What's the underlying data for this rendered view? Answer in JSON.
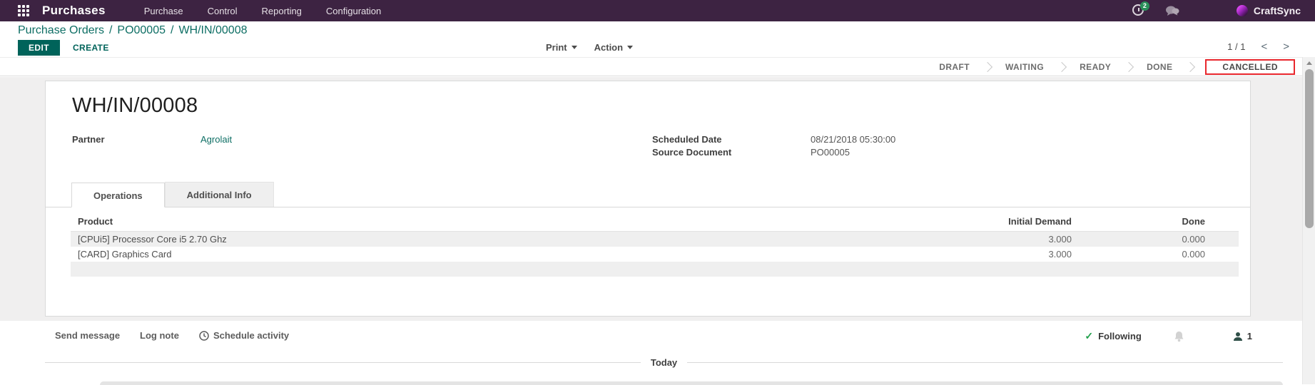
{
  "topbar": {
    "app_name": "Purchases",
    "menus": [
      "Purchase",
      "Control",
      "Reporting",
      "Configuration"
    ],
    "activity_badge": "2",
    "company": "CraftSync"
  },
  "control_panel": {
    "breadcrumb": [
      "Purchase Orders",
      "PO00005",
      "WH/IN/00008"
    ],
    "separator": "/",
    "edit_label": "EDIT",
    "create_label": "CREATE",
    "print_label": "Print",
    "action_label": "Action",
    "pager": "1 / 1",
    "pager_prev": "<",
    "pager_next": ">"
  },
  "statusbar": {
    "states": [
      "DRAFT",
      "WAITING",
      "READY",
      "DONE",
      "CANCELLED"
    ],
    "active": "CANCELLED"
  },
  "sheet": {
    "title": "WH/IN/00008",
    "partner": {
      "label": "Partner",
      "value": "Agrolait"
    },
    "scheduled_date": {
      "label": "Scheduled Date",
      "value": "08/21/2018 05:30:00"
    },
    "source_document": {
      "label": "Source Document",
      "value": "PO00005"
    },
    "tabs": [
      "Operations",
      "Additional Info"
    ],
    "active_tab": "Operations",
    "table": {
      "columns": [
        "Product",
        "Initial Demand",
        "Done"
      ],
      "rows": [
        {
          "product": "[CPUi5] Processor Core i5 2.70 Ghz",
          "initial_demand": "3.000",
          "done": "0.000"
        },
        {
          "product": "[CARD] Graphics Card",
          "initial_demand": "3.000",
          "done": "0.000"
        }
      ]
    }
  },
  "chatter": {
    "send_message": "Send message",
    "log_note": "Log note",
    "schedule_activity": "Schedule activity",
    "following_label": "Following",
    "followers_count": "1",
    "divider": "Today"
  },
  "colors": {
    "topbar_background": "#3d2342",
    "accent_teal": "#00635a",
    "link_teal": "#0d6e64",
    "annotation_red": "#e8272d",
    "row_stripe": "#efefef"
  }
}
